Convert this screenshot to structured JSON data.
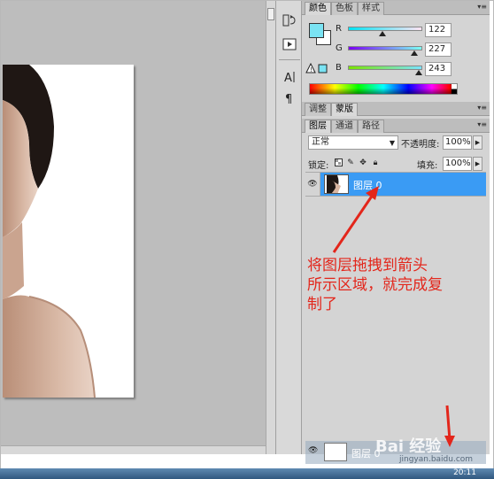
{
  "color_panel": {
    "tabs": [
      "颜色",
      "色板",
      "样式"
    ],
    "fg_color": "#7ae3f3",
    "bg_color": "#ffffff",
    "r": {
      "label": "R",
      "value": "122"
    },
    "g": {
      "label": "G",
      "value": "227"
    },
    "b": {
      "label": "B",
      "value": "243"
    }
  },
  "adjust_tabs": [
    "调整",
    "蒙版"
  ],
  "layers_panel": {
    "tabs": [
      "图层",
      "通道",
      "路径"
    ],
    "blend_mode": "正常",
    "opacity_label": "不透明度:",
    "opacity_value": "100%",
    "lock_label": "锁定:",
    "fill_label": "填充:",
    "fill_value": "100%",
    "layer_name": "图层 0",
    "dragged_layer_name": "图层 0"
  },
  "annotation": {
    "line1": "将图层拖拽到箭头",
    "line2": "所示区域，就完成复",
    "line3": "制了"
  },
  "watermark": {
    "main": "Bai 经验",
    "sub": "jingyan.baidu.com"
  },
  "taskbar": {
    "clock": "20:11"
  },
  "colors": {
    "accent_red": "#e3261b",
    "selection_blue": "#3a9bf4"
  }
}
